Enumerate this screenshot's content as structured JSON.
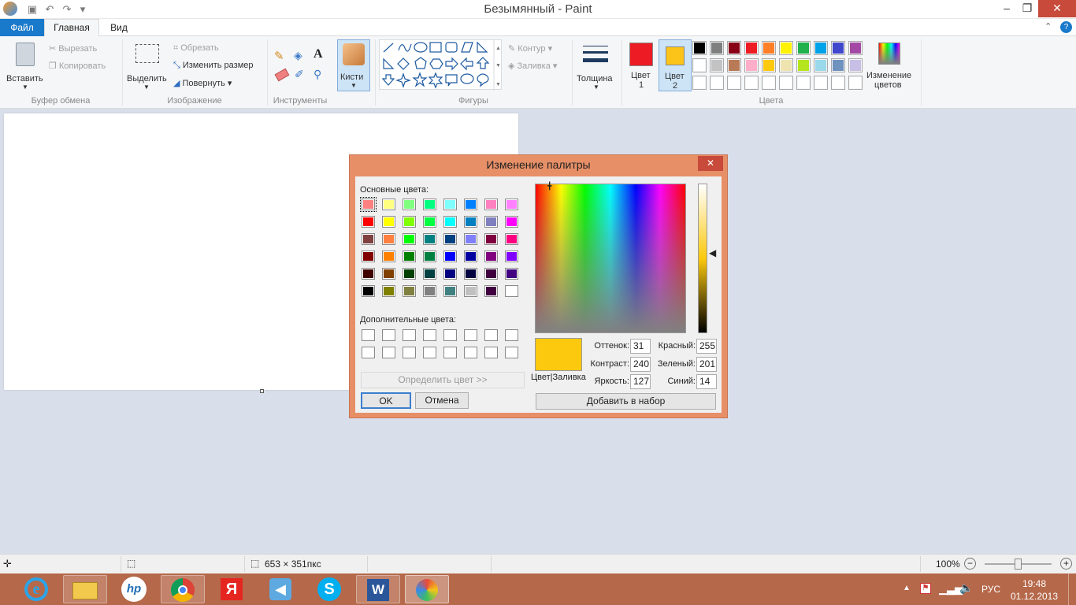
{
  "window": {
    "title": "Безымянный - Paint",
    "minimize": "–",
    "maximize": "❐",
    "close": "✕"
  },
  "tabs": {
    "file": "Файл",
    "home": "Главная",
    "view": "Вид"
  },
  "ribbon": {
    "clipboard": {
      "paste": "Вставить",
      "cut": "Вырезать",
      "copy": "Копировать",
      "label": "Буфер обмена"
    },
    "image": {
      "select": "Выделить",
      "crop": "Обрезать",
      "resize": "Изменить размер",
      "rotate": "Повернуть",
      "label": "Изображение"
    },
    "tools": {
      "label": "Инструменты"
    },
    "brushes": {
      "label": "Кисти"
    },
    "shapes": {
      "outline": "Контур",
      "fill": "Заливка",
      "label": "Фигуры"
    },
    "size": {
      "label": "Толщина"
    },
    "colors": {
      "color1": "Цвет",
      "color1_num": "1",
      "color1_value": "#ed1c24",
      "color2": "Цвет",
      "color2_num": "2",
      "color2_value": "#fcc419",
      "edit": "Изменение",
      "edit2": "цветов",
      "label": "Цвета",
      "palette_row1": [
        "#000000",
        "#7f7f7f",
        "#880015",
        "#ed1c24",
        "#ff7f27",
        "#fff200",
        "#22b14c",
        "#00a2e8",
        "#3f48cc",
        "#a349a4"
      ],
      "palette_row2": [
        "#ffffff",
        "#c3c3c3",
        "#b97a57",
        "#ffaec9",
        "#ffc90e",
        "#efe4b0",
        "#b5e61d",
        "#99d9ea",
        "#7092be",
        "#c8bfe7"
      ]
    }
  },
  "status": {
    "size": "653 × 351пкс",
    "zoom": "100%"
  },
  "taskbar": {
    "lang": "РУС",
    "time": "19:48",
    "date": "01.12.2013"
  },
  "dialog": {
    "title": "Изменение палитры",
    "basic_label": "Основные цвета:",
    "custom_label": "Дополнительные цвета:",
    "define": "Определить цвет >>",
    "ok": "OK",
    "cancel": "Отмена",
    "add": "Добавить в набор",
    "preview_label": "Цвет|Заливка",
    "preview_color": "#fcc90e",
    "hue_label": "Оттенок:",
    "hue": "31",
    "sat_label": "Контраст:",
    "sat": "240",
    "lum_label": "Яркость:",
    "lum": "127",
    "red_label": "Красный:",
    "red": "255",
    "green_label": "Зеленый:",
    "green": "201",
    "blue_label": "Синий:",
    "blue": "14",
    "basic_colors": [
      [
        "#ff8080",
        "#ffff80",
        "#80ff80",
        "#00ff80",
        "#80ffff",
        "#0080ff",
        "#ff80c0",
        "#ff80ff"
      ],
      [
        "#ff0000",
        "#ffff00",
        "#80ff00",
        "#00ff40",
        "#00ffff",
        "#0080c0",
        "#8080c0",
        "#ff00ff"
      ],
      [
        "#804040",
        "#ff8040",
        "#00ff00",
        "#008080",
        "#004080",
        "#8080ff",
        "#800040",
        "#ff0080"
      ],
      [
        "#800000",
        "#ff8000",
        "#008000",
        "#008040",
        "#0000ff",
        "#0000a0",
        "#800080",
        "#8000ff"
      ],
      [
        "#400000",
        "#804000",
        "#004000",
        "#004040",
        "#000080",
        "#000040",
        "#400040",
        "#400080"
      ],
      [
        "#000000",
        "#808000",
        "#808040",
        "#808080",
        "#408080",
        "#c0c0c0",
        "#400040",
        "#ffffff"
      ]
    ]
  }
}
